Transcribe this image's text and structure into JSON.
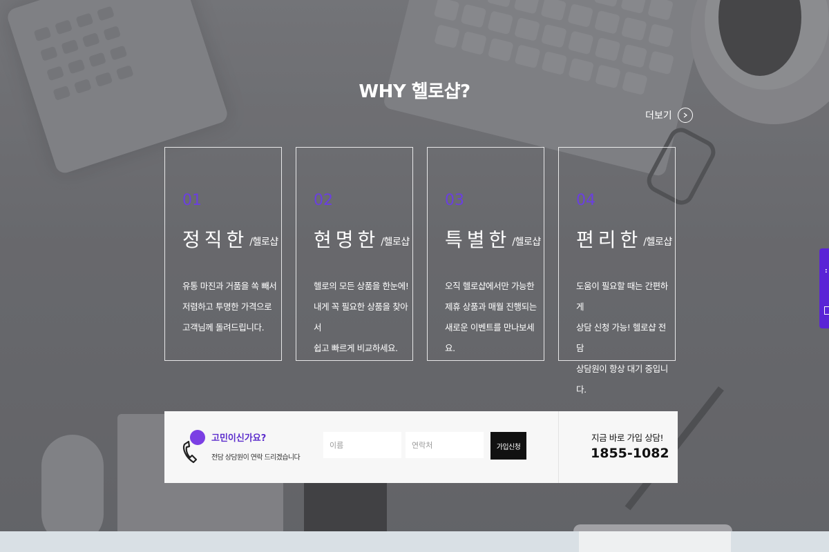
{
  "section": {
    "title": "WHY 헬로샵?",
    "more_label": "더보기"
  },
  "cards": [
    {
      "number": "01",
      "headline": "정직한",
      "brand": "/헬로샵",
      "description": "유통 마진과 거품을 쏙 빼서\n저렴하고 투명한 가격으로\n고객님께 돌려드립니다."
    },
    {
      "number": "02",
      "headline": "현명한",
      "brand": "/헬로샵",
      "description": "헬로의 모든 상품을 한눈에!\n내게 꼭 필요한 상품을 찾아서\n쉽고 빠르게 비교하세요."
    },
    {
      "number": "03",
      "headline": "특별한",
      "brand": "/헬로샵",
      "description": "오직 헬로샵에서만 가능한\n제휴 상품과 매월 진행되는\n새로운 이벤트를 만나보세요."
    },
    {
      "number": "04",
      "headline": "편리한",
      "brand": "/헬로샵",
      "description": "도움이 필요할 때는 간편하게\n상담 신청 가능! 헬로샵 전담\n상담원이 항상 대기 중입니다."
    }
  ],
  "consult": {
    "title": "고민이신가요?",
    "subtitle": "전담 상담원이 연락 드리겠습니다",
    "name_placeholder": "이름",
    "contact_placeholder": "연락처",
    "submit_label": "가입신청",
    "call_label": "지금 바로 가입 상담!",
    "call_number": "1855-1082"
  },
  "colors": {
    "accent": "#6a3fe0",
    "side_tab": "#5a24d6",
    "button": "#111111"
  },
  "icons": {
    "more": "chevron-right-circle-icon",
    "consult": "phone-chat-icon"
  }
}
